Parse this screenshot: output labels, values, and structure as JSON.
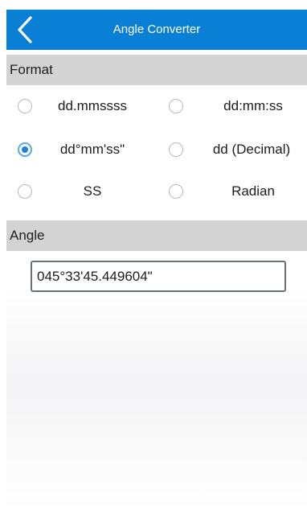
{
  "header": {
    "title": "Angle Converter",
    "back_icon": "chevron-left-icon",
    "background": "#0a7fd6"
  },
  "format_section": {
    "title": "Format",
    "options": [
      {
        "label": "dd.mmssss",
        "checked": false
      },
      {
        "label": "dd:mm:ss",
        "checked": false
      },
      {
        "label": "dd°mm'ss\"",
        "checked": true
      },
      {
        "label": "dd (Decimal)",
        "checked": false
      },
      {
        "label": "SS",
        "checked": false
      },
      {
        "label": "Radian",
        "checked": false
      }
    ]
  },
  "angle_section": {
    "title": "Angle",
    "value": "045°33'45.449604\""
  },
  "colors": {
    "accent": "#1c83da",
    "section_bar": "#d3d3d3"
  }
}
